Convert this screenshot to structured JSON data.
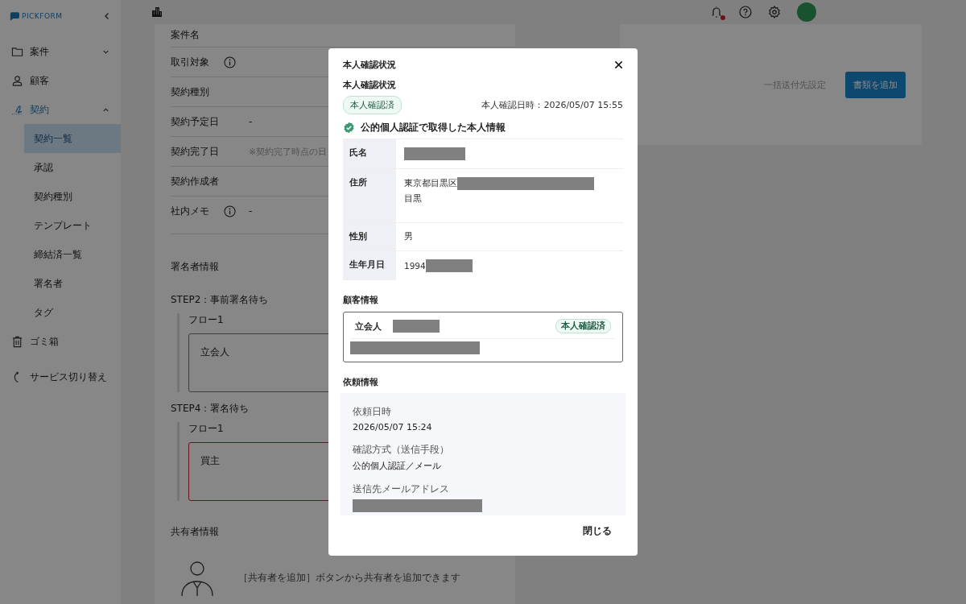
{
  "sidebar": {
    "logo": "PICKFORM",
    "items": [
      {
        "label": "案件",
        "expanded": false
      },
      {
        "label": "顧客"
      },
      {
        "label": "契約",
        "expanded": true,
        "selected": true,
        "children": [
          {
            "label": "契約一覧",
            "selected": true
          },
          {
            "label": "承認",
            "selected": false
          },
          {
            "label": "契約種別",
            "selected": false
          },
          {
            "label": "テンプレート",
            "selected": false
          },
          {
            "label": "締結済一覧",
            "selected": false
          },
          {
            "label": "署名者",
            "selected": false
          },
          {
            "label": "タグ",
            "selected": false
          }
        ]
      },
      {
        "label": "ゴミ箱"
      },
      {
        "label": "サービス切り替え"
      }
    ]
  },
  "topbar": {
    "notification": true
  },
  "details": {
    "rows": [
      {
        "label": "案件名"
      },
      {
        "label": "取引対象",
        "info": true
      },
      {
        "label": "契約種別"
      },
      {
        "label": "契約予定日",
        "value": "-"
      },
      {
        "label": "契約完了日",
        "value": "※契約完了時点の日",
        "muted": true
      },
      {
        "label": "契約作成者"
      },
      {
        "label": "社内メモ",
        "info": true,
        "value": "-"
      }
    ]
  },
  "signers": {
    "title": "署名者情報",
    "steps": [
      {
        "title": "STEP2：事前署名待ち",
        "flows": [
          {
            "title": "フロー1",
            "role": "立会人",
            "alert": false
          }
        ]
      },
      {
        "title": "STEP4：署名待ち",
        "flows": [
          {
            "title": "フロー1",
            "role": "買主",
            "alert": true
          }
        ]
      }
    ]
  },
  "sharers": {
    "title": "共有者情報",
    "hint": "［共有者を追加］ボタンから共有者を追加できます"
  },
  "documents": {
    "buttons": [
      {
        "label": "一括送付先設定",
        "kind": "text"
      },
      {
        "label": "書類を追加",
        "kind": "primary"
      }
    ]
  },
  "modal": {
    "title": "本人確認状況",
    "section_title": "本人確認状況",
    "status_badge": "本人確認済",
    "verified_at": "本人確認日時：2026/05/07 15:55",
    "identity_heading": "公的個人認証で取得した本人情報",
    "identity_rows": [
      {
        "label": "氏名",
        "redacted": true
      },
      {
        "label": "住所",
        "value": "東京都目黒区",
        "redacted": true,
        "line2": "目黒"
      },
      {
        "label": "性別",
        "value": "男"
      },
      {
        "label": "生年月日",
        "value": "1994",
        "redacted": true
      }
    ],
    "customer": {
      "title": "顧客情報",
      "role": "立会人",
      "badge": "本人確認済"
    },
    "request": {
      "title": "依頼情報",
      "fields": [
        {
          "label": "依頼日時",
          "value": "2026/05/07 15:24"
        },
        {
          "label": "確認方式（送信手段）",
          "value": "公的個人認証／メール"
        },
        {
          "label": "送信先メールアドレス",
          "redacted": true
        }
      ]
    },
    "close_button": "閉じる"
  }
}
